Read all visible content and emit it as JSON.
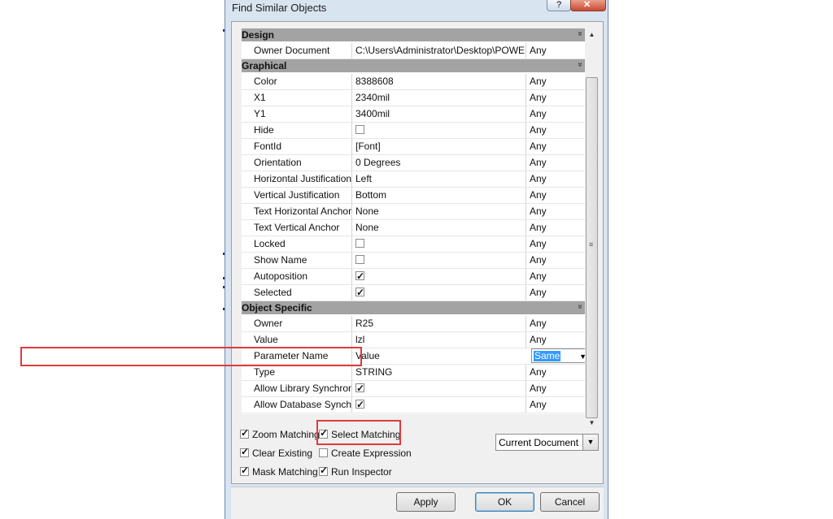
{
  "window": {
    "title": "Find Similar Objects",
    "help_glyph": "?",
    "close_icon": "close-icon"
  },
  "sections": [
    {
      "label": "Design",
      "rows": [
        {
          "name": "Owner Document",
          "value": "C:\\Users\\Administrator\\Desktop\\POWER.Sc",
          "kind": "Any"
        }
      ]
    },
    {
      "label": "Graphical",
      "rows": [
        {
          "name": "Color",
          "value": "8388608",
          "kind": "Any"
        },
        {
          "name": "X1",
          "value": "2340mil",
          "kind": "Any"
        },
        {
          "name": "Y1",
          "value": "3400mil",
          "kind": "Any"
        },
        {
          "name": "Hide",
          "checkbox": false,
          "kind": "Any"
        },
        {
          "name": "FontId",
          "value": "[Font]",
          "kind": "Any"
        },
        {
          "name": "Orientation",
          "value": "0 Degrees",
          "kind": "Any"
        },
        {
          "name": "Horizontal Justification",
          "value": "Left",
          "kind": "Any"
        },
        {
          "name": "Vertical Justification",
          "value": "Bottom",
          "kind": "Any"
        },
        {
          "name": "Text Horizontal Anchor",
          "value": "None",
          "kind": "Any"
        },
        {
          "name": "Text Vertical Anchor",
          "value": "None",
          "kind": "Any"
        },
        {
          "name": "Locked",
          "checkbox": false,
          "kind": "Any"
        },
        {
          "name": "Show Name",
          "checkbox": false,
          "kind": "Any"
        },
        {
          "name": "Autoposition",
          "checkbox": true,
          "kind": "Any"
        },
        {
          "name": "Selected",
          "checkbox": true,
          "kind": "Any"
        }
      ]
    },
    {
      "label": "Object Specific",
      "rows": [
        {
          "name": "Owner",
          "value": "R25",
          "kind": "Any"
        },
        {
          "name": "Value",
          "value": "lzl",
          "kind": "Any"
        },
        {
          "name": "Parameter Name",
          "value": "Value",
          "kind": "Same",
          "selected": true
        },
        {
          "name": "Type",
          "value": "STRING",
          "kind": "Any"
        },
        {
          "name": "Allow Library Synchronization",
          "checkbox": true,
          "kind": "Any"
        },
        {
          "name": "Allow Database Synchronization",
          "checkbox": true,
          "kind": "Any"
        }
      ]
    }
  ],
  "options": [
    {
      "label": "Zoom Matching",
      "checked": true
    },
    {
      "label": "Select Matching",
      "checked": true
    },
    {
      "label": "Clear Existing",
      "checked": true
    },
    {
      "label": "Create Expression",
      "checked": false
    },
    {
      "label": "Mask Matching",
      "checked": true
    },
    {
      "label": "Run Inspector",
      "checked": true
    }
  ],
  "scope": {
    "value": "Current Document"
  },
  "buttons": {
    "apply": "Apply",
    "ok": "OK",
    "cancel": "Cancel"
  },
  "colors": {
    "highlight": "#e03b3b",
    "selection": "#3399ff",
    "category_bar": "#a3a3a3"
  }
}
